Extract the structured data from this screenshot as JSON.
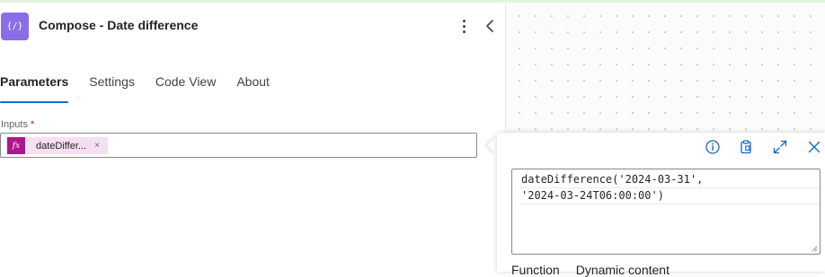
{
  "header": {
    "icon_glyph": "{/}",
    "title": "Compose - Date difference"
  },
  "tabs": [
    {
      "label": "Parameters",
      "active": true
    },
    {
      "label": "Settings",
      "active": false
    },
    {
      "label": "Code View",
      "active": false
    },
    {
      "label": "About",
      "active": false
    }
  ],
  "inputs": {
    "label": "Inputs",
    "required_mark": "*",
    "token": {
      "icon_glyph": "fx",
      "text": "dateDiffer...",
      "remove_glyph": "×"
    }
  },
  "expression_editor": {
    "lines": [
      "dateDifference('2024-03-31',",
      "'2024-03-24T06:00:00')"
    ],
    "tabs": [
      "Function",
      "Dynamic content"
    ]
  },
  "colors": {
    "accent": "#0f6cbd",
    "header_icon_bg": "#8a6ee6",
    "token_bg": "#f5e0f3",
    "token_icon_bg": "#b0168c",
    "required": "#c50f1f",
    "top_strip": "#dff6dd"
  }
}
